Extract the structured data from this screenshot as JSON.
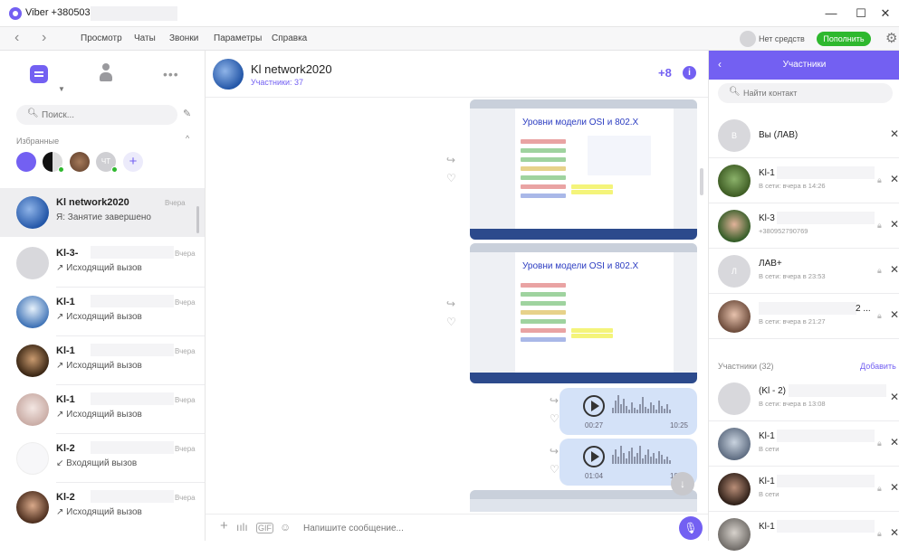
{
  "window": {
    "title": "Viber +3805031",
    "minimize": "—",
    "maximize": "☐",
    "close": "✕"
  },
  "menubar": {
    "back": "‹",
    "forward": "›",
    "items": [
      "Просмотр",
      "Чаты",
      "Звонки",
      "Параметры",
      "Справка"
    ],
    "balance": "Нет средств",
    "topup": "Пополнить",
    "settings_icon": "gear-icon"
  },
  "left": {
    "search_placeholder": "Поиск...",
    "favorites_label": "Избранные",
    "fav_add": "+",
    "fav_badge": "ЧТ",
    "chats": [
      {
        "name": "Kl network2020",
        "time": "Вчера",
        "preview": "Я: Занятие завершено",
        "selected": true
      },
      {
        "name": "Kl-3-",
        "time": "Вчера",
        "preview": "↗ Исходящий вызов"
      },
      {
        "name": "Kl-1",
        "time": "Вчера",
        "preview": "↗ Исходящий вызов"
      },
      {
        "name": "Kl-1",
        "time": "Вчера",
        "preview": "↗ Исходящий вызов"
      },
      {
        "name": "Kl-1",
        "time": "Вчера",
        "preview": "↗ Исходящий вызов"
      },
      {
        "name": "Kl-2",
        "time": "Вчера",
        "preview": "↙ Входящий вызов"
      },
      {
        "name": "Kl-2",
        "time": "Вчера",
        "preview": "↗ Исходящий вызов"
      }
    ]
  },
  "chat": {
    "title": "Kl network2020",
    "subtitle": "Участники: 37",
    "slide_title": "Уровни модели OSI и 802.X",
    "voice": [
      {
        "duration": "00:27",
        "time": "10:25"
      },
      {
        "duration": "01:04",
        "time": "10:26"
      }
    ],
    "composer_placeholder": "Напишите сообщение..."
  },
  "participants": {
    "title": "Участники",
    "search_placeholder": "Найти контакт",
    "top": [
      {
        "initial": "В",
        "name": "Вы (ЛАВ)",
        "status": ""
      },
      {
        "name": "Kl-1",
        "status": "В сети: вчера в 14:26"
      },
      {
        "name": "Kl-3",
        "status": "+380952790769"
      },
      {
        "initial": "Л",
        "name": "ЛАВ+",
        "status": "В сети: вчера в 23:53"
      },
      {
        "name": "2 ...",
        "status": "В сети: вчера в 21:27"
      }
    ],
    "section_label": "Участники (32)",
    "add_label": "Добавить",
    "list": [
      {
        "name": "(Kl - 2)",
        "status": "В сети: вчера в 13:08"
      },
      {
        "name": "Kl-1",
        "status": "В сети"
      },
      {
        "name": "Kl-1",
        "status": "В сети"
      },
      {
        "name": "Kl-1",
        "status": ""
      }
    ]
  },
  "colors": {
    "accent": "#7360f2",
    "topup": "#2eb82e"
  }
}
